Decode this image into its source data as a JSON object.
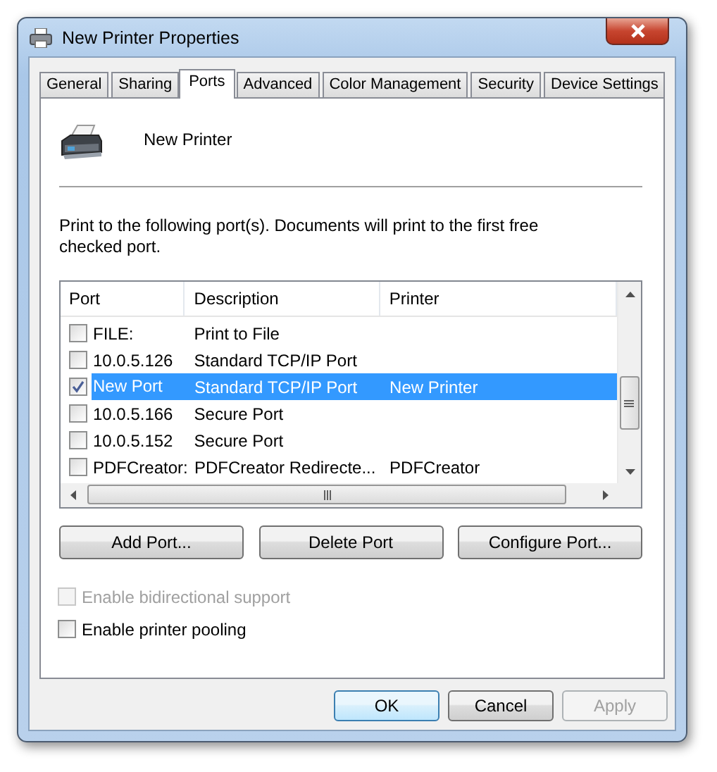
{
  "window": {
    "title": "New Printer Properties"
  },
  "tabs": [
    {
      "label": "General",
      "selected": false
    },
    {
      "label": "Sharing",
      "selected": false
    },
    {
      "label": "Ports",
      "selected": true
    },
    {
      "label": "Advanced",
      "selected": false
    },
    {
      "label": "Color Management",
      "selected": false
    },
    {
      "label": "Security",
      "selected": false
    },
    {
      "label": "Device Settings",
      "selected": false
    }
  ],
  "printer_name": "New Printer",
  "instructions": "Print to the following port(s). Documents will print to the first free checked port.",
  "port_list": {
    "columns": [
      "Port",
      "Description",
      "Printer"
    ],
    "rows": [
      {
        "port": "FILE:",
        "description": "Print to File",
        "checked": false,
        "selected": false
      },
      {
        "port": "10.0.5.126",
        "description": "Standard TCP/IP Port",
        "checked": false,
        "selected": false
      },
      {
        "port": "New Port",
        "description": "Standard TCP/IP Port",
        "printer": "New Printer",
        "checked": true,
        "selected": true
      },
      {
        "port": "10.0.5.166",
        "description": "Secure Port",
        "checked": false,
        "selected": false
      },
      {
        "port": "10.0.5.152",
        "description": "Secure Port",
        "checked": false,
        "selected": false
      },
      {
        "port": "PDFCreator:",
        "description": "PDFCreator Redirecte...",
        "printer": "PDFCreator",
        "checked": false,
        "selected": false
      }
    ]
  },
  "port_buttons": [
    "Add Port...",
    "Delete Port",
    "Configure Port..."
  ],
  "options": [
    {
      "label": "Enable bidirectional support",
      "checked": false,
      "disabled": true
    },
    {
      "label": "Enable printer pooling",
      "checked": false,
      "disabled": false
    }
  ],
  "dialog_buttons": [
    {
      "label": "OK",
      "default": true,
      "disabled": false
    },
    {
      "label": "Cancel",
      "default": false,
      "disabled": false
    },
    {
      "label": "Apply",
      "default": false,
      "disabled": true
    }
  ]
}
